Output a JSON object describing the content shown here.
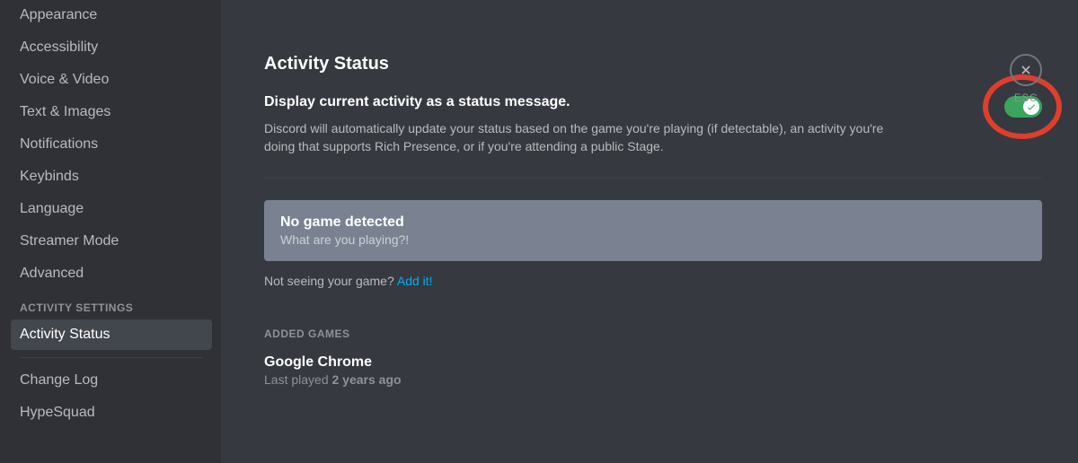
{
  "sidebar": {
    "items_top": [
      "Appearance",
      "Accessibility",
      "Voice & Video",
      "Text & Images",
      "Notifications",
      "Keybinds",
      "Language",
      "Streamer Mode",
      "Advanced"
    ],
    "section_header": "ACTIVITY SETTINGS",
    "active_item": "Activity Status",
    "items_bottom": [
      "Change Log",
      "HypeSquad"
    ]
  },
  "main": {
    "title": "Activity Status",
    "toggle_label": "Display current activity as a status message.",
    "toggle_desc": "Discord will automatically update your status based on the game you're playing (if detectable), an activity you're doing that supports Rich Presence, or if you're attending a public Stage.",
    "toggle_on": true,
    "game_box": {
      "title": "No game detected",
      "subtitle": "What are you playing?!"
    },
    "hint_text": "Not seeing your game? ",
    "hint_link": "Add it!",
    "added_section_header": "ADDED GAMES",
    "added_games": [
      {
        "name": "Google Chrome",
        "last_played_prefix": "Last played ",
        "last_played_ago": "2 years ago"
      }
    ]
  },
  "close": {
    "label": "ESC"
  }
}
